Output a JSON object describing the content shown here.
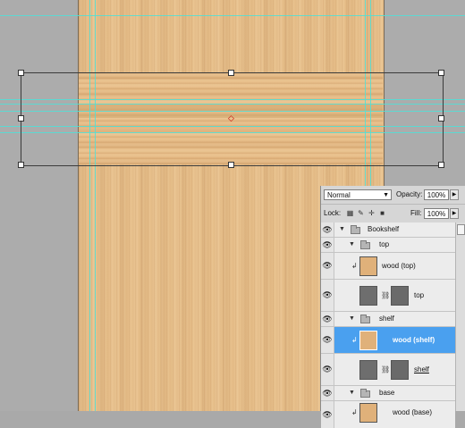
{
  "layers_panel": {
    "blend_mode": "Normal",
    "opacity_label": "Opacity:",
    "opacity_value": "100%",
    "lock_label": "Lock:",
    "fill_label": "Fill:",
    "fill_value": "100%",
    "layers": [
      {
        "name": "Bookshelf",
        "type": "group"
      },
      {
        "name": "top",
        "type": "group"
      },
      {
        "name": "wood (top)",
        "type": "layer"
      },
      {
        "name": "top",
        "type": "shape"
      },
      {
        "name": "shelf",
        "type": "group"
      },
      {
        "name": "wood (shelf)",
        "type": "layer",
        "selected": true
      },
      {
        "name": "shelf",
        "type": "shape"
      },
      {
        "name": "base",
        "type": "group"
      },
      {
        "name": "wood (base)",
        "type": "layer"
      }
    ]
  },
  "colors": {
    "wood": "#e7bf8a",
    "guide": "#4ee0d8",
    "selection": "#4aa0ef",
    "canvas_bg": "#acacac"
  }
}
